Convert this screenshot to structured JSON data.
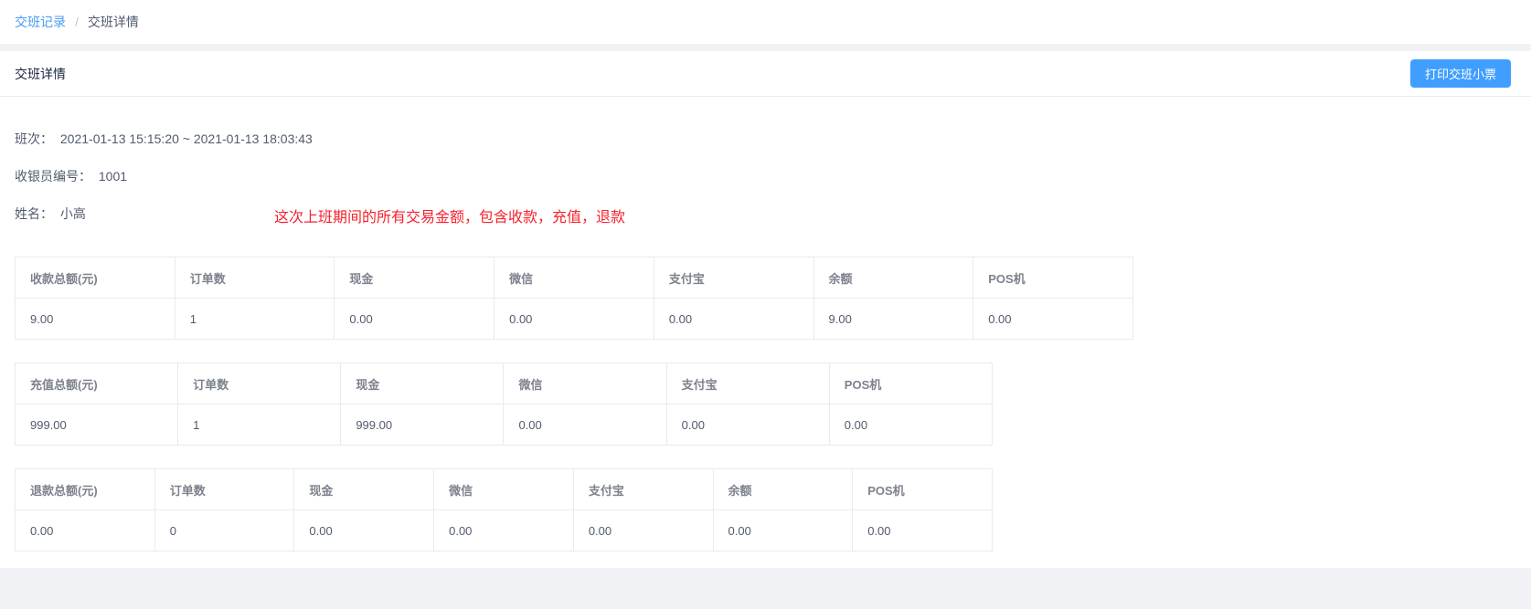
{
  "breadcrumb": {
    "link": "交班记录",
    "separator": "/",
    "current": "交班详情"
  },
  "header": {
    "title": "交班详情",
    "print_button": "打印交班小票"
  },
  "info": {
    "shift_label": "班次：",
    "shift_value": "2021-01-13 15:15:20 ~ 2021-01-13 18:03:43",
    "cashier_no_label": "收银员编号：",
    "cashier_no_value": "1001",
    "name_label": "姓名：",
    "name_value": "小高"
  },
  "annotation": {
    "text": "这次上班期间的所有交易金额，包含收款，充值，退款",
    "color": "#f5222d"
  },
  "tables": [
    {
      "name": "collection",
      "headers": [
        "收款总额(元)",
        "订单数",
        "现金",
        "微信",
        "支付宝",
        "余额",
        "POS机"
      ],
      "values": [
        "9.00",
        "1",
        "0.00",
        "0.00",
        "0.00",
        "9.00",
        "0.00"
      ]
    },
    {
      "name": "recharge",
      "headers": [
        "充值总额(元)",
        "订单数",
        "现金",
        "微信",
        "支付宝",
        "POS机"
      ],
      "values": [
        "999.00",
        "1",
        "999.00",
        "0.00",
        "0.00",
        "0.00"
      ]
    },
    {
      "name": "refund",
      "headers": [
        "退款总额(元)",
        "订单数",
        "现金",
        "微信",
        "支付宝",
        "余额",
        "POS机"
      ],
      "values": [
        "0.00",
        "0",
        "0.00",
        "0.00",
        "0.00",
        "0.00",
        "0.00"
      ]
    }
  ],
  "colors": {
    "primary_blue": "#409eff",
    "annotation_red": "#f5222d",
    "table_border": "#e8eaec",
    "page_background": "#f0f2f5"
  }
}
